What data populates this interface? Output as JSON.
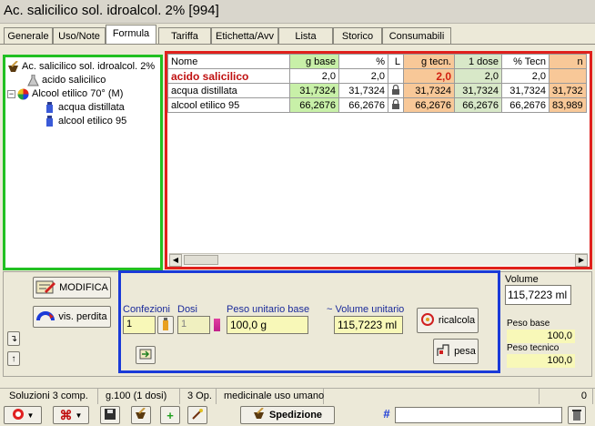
{
  "window": {
    "title": "Ac. salicilico sol. idroalcol. 2%  [994]"
  },
  "tabs": [
    {
      "label": "Generale"
    },
    {
      "label": "Uso/Note"
    },
    {
      "label": "Formula"
    },
    {
      "label": "Tariffa"
    },
    {
      "label": "Etichetta/Avv"
    },
    {
      "label": "Lista"
    },
    {
      "label": "Storico"
    },
    {
      "label": "Consumabili"
    }
  ],
  "tree": {
    "root": "Ac. salicilico sol. idroalcol. 2%",
    "child1": "acido salicilico",
    "child2": "Alcool etilico 70° (M)",
    "grandchild1": "acqua distillata",
    "grandchild2": "alcool etilico 95"
  },
  "grid": {
    "headers": [
      "Nome",
      "g base",
      "%",
      "L",
      "g tecn.",
      "1 dose",
      "% Tecn",
      "n"
    ],
    "rows": [
      {
        "nome": "acido salicilico",
        "gbase": "2,0",
        "perc": "2,0",
        "gtecn": "2,0",
        "dose": "2,0",
        "ptecn": "2,0",
        "extra": ""
      },
      {
        "nome": "acqua distillata",
        "gbase": "31,7324",
        "perc": "31,7324",
        "gtecn": "31,7324",
        "dose": "31,7324",
        "ptecn": "31,7324",
        "extra": "31,732"
      },
      {
        "nome": "alcool etilico 95",
        "gbase": "66,2676",
        "perc": "66,2676",
        "gtecn": "66,2676",
        "dose": "66,2676",
        "ptecn": "66,2676",
        "extra": "83,989"
      }
    ]
  },
  "buttons": {
    "modifica": "MODIFICA",
    "vis_perdita": "vis. perdita",
    "ricalcola": "ricalcola",
    "pesa": "pesa",
    "spedizione": "Spedizione"
  },
  "calc": {
    "confezioni_label": "Confezioni",
    "confezioni_value": "1",
    "dosi_label": "Dosi",
    "dosi_value": "1",
    "peso_label": "Peso unitario base",
    "peso_value": "100,0 g",
    "volume_label": "~ Volume unitario",
    "volume_value": "115,7223 ml"
  },
  "side": {
    "volume_label": "Volume",
    "volume_value": "115,7223 ml",
    "peso_base_label": "Peso base",
    "peso_base_value": "100,0",
    "peso_tecnico_label": "Peso tecnico",
    "peso_tecnico_value": "100,0"
  },
  "status": {
    "soluzioni": "Soluzioni  3 comp.",
    "base": "g.100  (1 dosi)",
    "op": "3 Op.",
    "uso": "medicinale uso umano",
    "count": "0"
  },
  "toolbar": {
    "hash": "#"
  },
  "colors": {
    "tree_border": "#22c022",
    "grid_border": "#e0201c",
    "calc_border": "#1a3ad8",
    "base_col": "#c8f0a8",
    "tecn_col": "#f8c898"
  }
}
